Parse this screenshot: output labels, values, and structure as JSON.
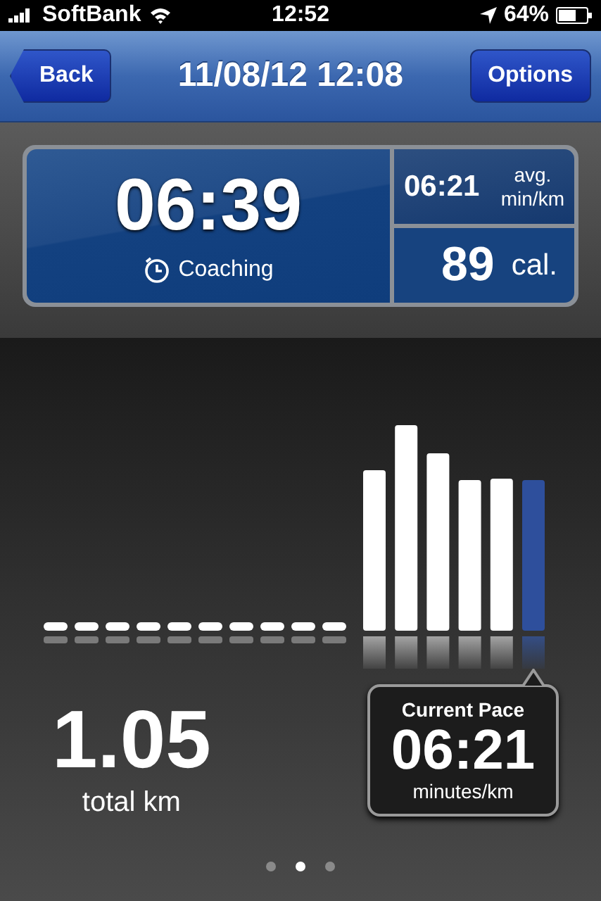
{
  "status_bar": {
    "carrier": "SoftBank",
    "time": "12:52",
    "battery": "64%"
  },
  "nav": {
    "back": "Back",
    "title": "11/08/12 12:08",
    "options": "Options"
  },
  "stats": {
    "duration": "06:39",
    "coaching": "Coaching",
    "avg_pace": "06:21",
    "avg_label": "avg.",
    "avg_unit": "min/km",
    "calories": "89",
    "calories_unit": "cal."
  },
  "distance": {
    "value": "1.05",
    "label": "total km"
  },
  "current_pace": {
    "title": "Current Pace",
    "value": "06:21",
    "unit": "minutes/km"
  },
  "page_dots": [
    {
      "selected": false
    },
    {
      "selected": true
    },
    {
      "selected": false
    }
  ]
}
